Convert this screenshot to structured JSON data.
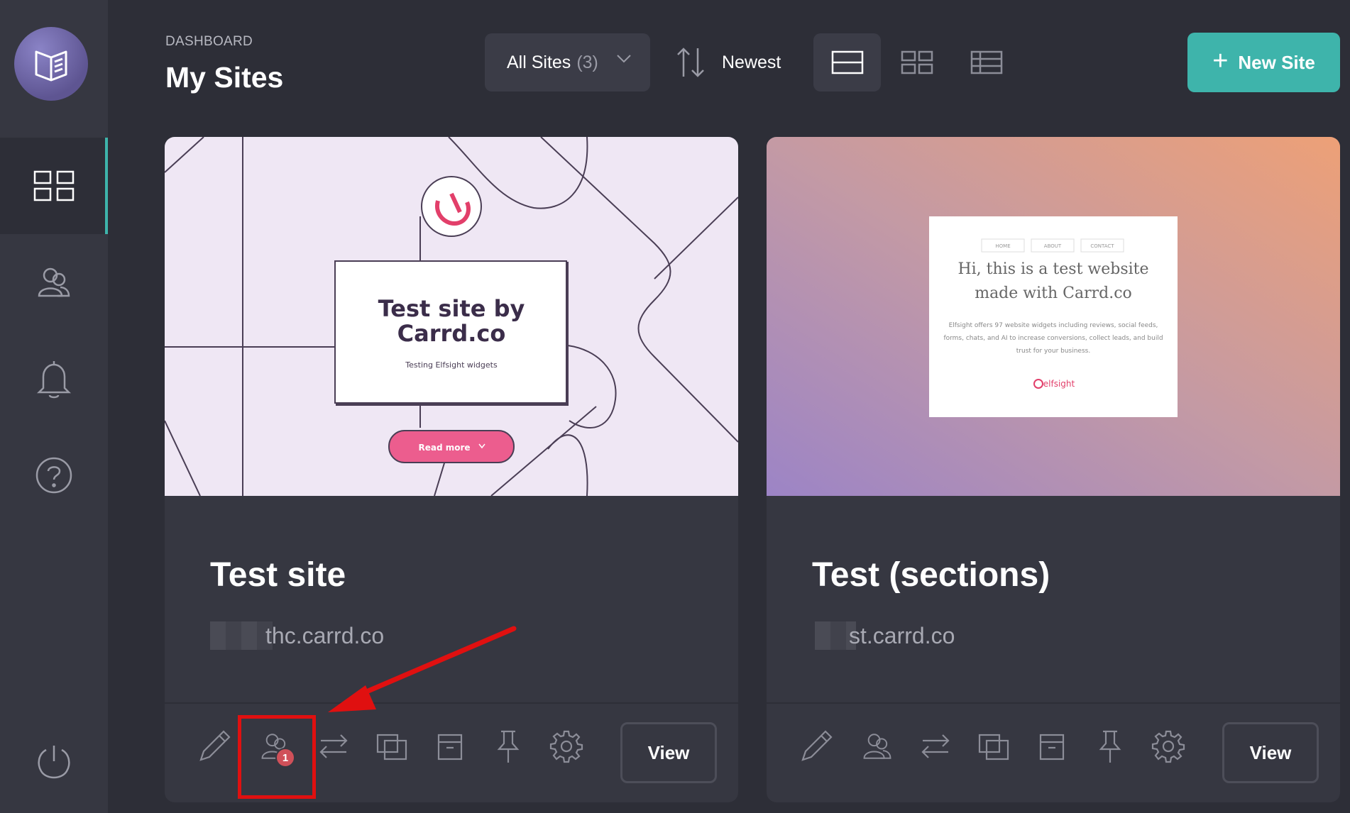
{
  "sidebar": {
    "items": [
      {
        "name": "dashboard",
        "icon": "dashboard-grid-icon",
        "active": true
      },
      {
        "name": "account",
        "icon": "users-icon",
        "active": false
      },
      {
        "name": "notifications",
        "icon": "bell-icon",
        "active": false
      },
      {
        "name": "help",
        "icon": "help-icon",
        "active": false
      },
      {
        "name": "logout",
        "icon": "power-icon",
        "active": false
      }
    ]
  },
  "header": {
    "breadcrumb": "DASHBOARD",
    "title": "My Sites",
    "filter": {
      "label": "All Sites",
      "count": "(3)"
    },
    "sort": {
      "label": "Newest"
    },
    "new_site": "New Site"
  },
  "sites": [
    {
      "title": "Test site",
      "url": "thc.carrd.co",
      "view_label": "View",
      "badge": "1",
      "preview": {
        "heading_line1": "Test site by",
        "heading_line2": "Carrd.co",
        "subtitle": "Testing Elfsight widgets",
        "button": "Read more"
      }
    },
    {
      "title": "Test (sections)",
      "url": "st.carrd.co",
      "view_label": "View",
      "preview": {
        "nav": [
          "HOME",
          "ABOUT",
          "CONTACT"
        ],
        "heading_line1": "Hi, this is a test website",
        "heading_line2": "made with Carrd.co",
        "body_line1": "Elfsight offers 97 website widgets including reviews, social feeds,",
        "body_line2": "forms, chats, and AI to increase conversions, collect leads, and build",
        "body_line3": "trust for your business.",
        "brand": "elfsight"
      }
    }
  ],
  "colors": {
    "accent": "#3eb4ab",
    "highlight": "#e01010",
    "badge": "#d05059"
  }
}
